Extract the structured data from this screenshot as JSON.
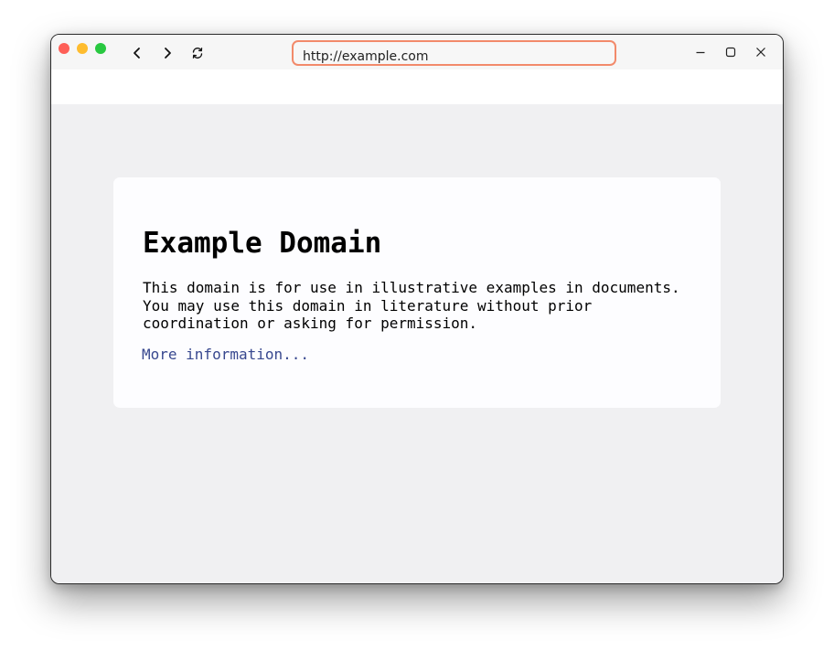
{
  "browser": {
    "url": "http://example.com",
    "nav": {
      "back_icon": "chevron-left-icon",
      "forward_icon": "chevron-right-icon",
      "reload_icon": "reload-icon"
    },
    "window_controls": {
      "minimize_icon": "minimize-icon",
      "maximize_icon": "maximize-icon",
      "close_icon": "close-icon"
    },
    "colors": {
      "close": "#fe5f57",
      "minimize": "#febc2e",
      "zoom": "#28c840",
      "url_focus_border": "#f28a6b"
    }
  },
  "page": {
    "title": "Example Domain",
    "description": "This domain is for use in illustrative examples in documents. You may use this domain in literature without prior coordination or asking for permission.",
    "link_text": "More information...",
    "colors": {
      "background": "#f0f0f2",
      "card": "#fdfdff",
      "link": "#38488f"
    }
  }
}
